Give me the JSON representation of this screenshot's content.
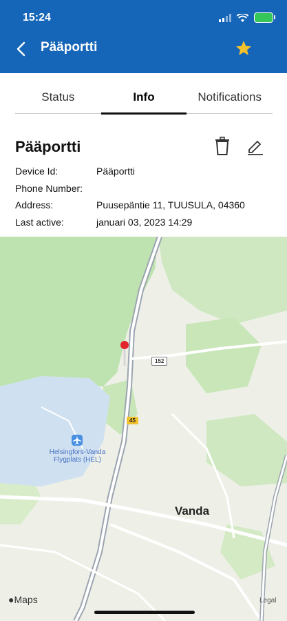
{
  "status_bar": {
    "time": "15:24"
  },
  "nav": {
    "title": "Pääportti"
  },
  "tabs": [
    {
      "label": "Status",
      "active": false
    },
    {
      "label": "Info",
      "active": true
    },
    {
      "label": "Notifications",
      "active": false
    }
  ],
  "device": {
    "title": "Pääportti",
    "rows": [
      {
        "label": "Device Id:",
        "value": "Pääportti"
      },
      {
        "label": "Phone Number:",
        "value": ""
      },
      {
        "label": "Address:",
        "value": "Puusepäntie 11, TUUSULA, 04360"
      },
      {
        "label": "Last active:",
        "value": "januari 03, 2023 14:29"
      }
    ]
  },
  "map": {
    "city_label": "Vanda",
    "airport_label": "Helsingfors-Vanda Flygplats (HEL)",
    "road_45": "45",
    "road_152": "152",
    "maps_brand": "Maps",
    "legal": "Legal"
  },
  "colors": {
    "header": "#1565b8",
    "star": "#f2c12e",
    "pin": "#e3262e"
  }
}
